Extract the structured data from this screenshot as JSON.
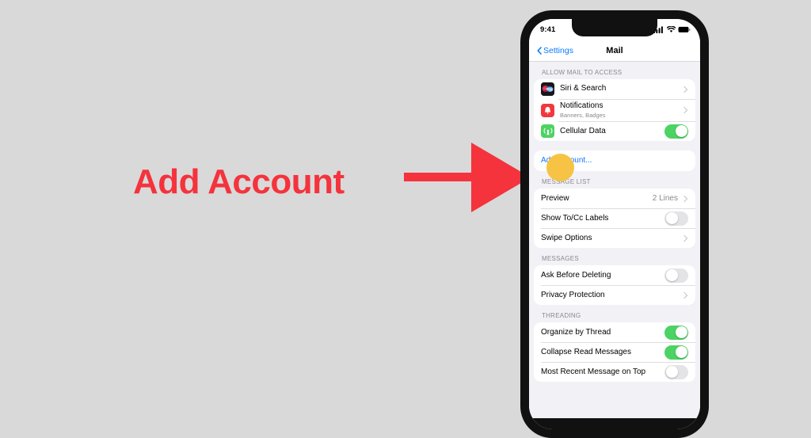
{
  "annotation": {
    "label": "Add Account",
    "color": "#f4333d",
    "arrow_icon": "right-arrow-icon"
  },
  "phone": {
    "status_bar": {
      "time": "9:41",
      "cellular_icon": "cellular-signal-icon",
      "wifi_icon": "wifi-icon",
      "battery_icon": "battery-icon"
    },
    "nav_bar": {
      "back_label": "Settings",
      "back_icon": "chevron-left-icon",
      "title": "Mail"
    },
    "sections": [
      {
        "header": "ALLOW MAIL TO ACCESS",
        "rows": [
          {
            "label": "Siri & Search",
            "icon": "siri-icon",
            "accessory": "chevron"
          },
          {
            "label": "Notifications",
            "sub": "Banners, Badges",
            "icon": "notifications-icon",
            "accessory": "chevron"
          },
          {
            "label": "Cellular Data",
            "icon": "cellular-data-icon",
            "accessory": "toggle",
            "toggle_on": true
          }
        ]
      },
      {
        "header": "",
        "rows": [
          {
            "label": "Add Account...",
            "link": true,
            "accessory": "none"
          }
        ]
      },
      {
        "header": "MESSAGE LIST",
        "rows": [
          {
            "label": "Preview",
            "value": "2 Lines",
            "accessory": "chevron"
          },
          {
            "label": "Show To/Cc Labels",
            "accessory": "toggle",
            "toggle_on": false
          },
          {
            "label": "Swipe Options",
            "accessory": "chevron"
          }
        ]
      },
      {
        "header": "MESSAGES",
        "rows": [
          {
            "label": "Ask Before Deleting",
            "accessory": "toggle",
            "toggle_on": false
          },
          {
            "label": "Privacy Protection",
            "accessory": "chevron"
          }
        ]
      },
      {
        "header": "THREADING",
        "rows": [
          {
            "label": "Organize by Thread",
            "accessory": "toggle",
            "toggle_on": true
          },
          {
            "label": "Collapse Read Messages",
            "accessory": "toggle",
            "toggle_on": true
          },
          {
            "label": "Most Recent Message on Top",
            "accessory": "toggle",
            "toggle_on": false
          }
        ]
      }
    ],
    "click_indicator": {
      "target_label": "Add Account...",
      "color": "#f6c344"
    }
  }
}
